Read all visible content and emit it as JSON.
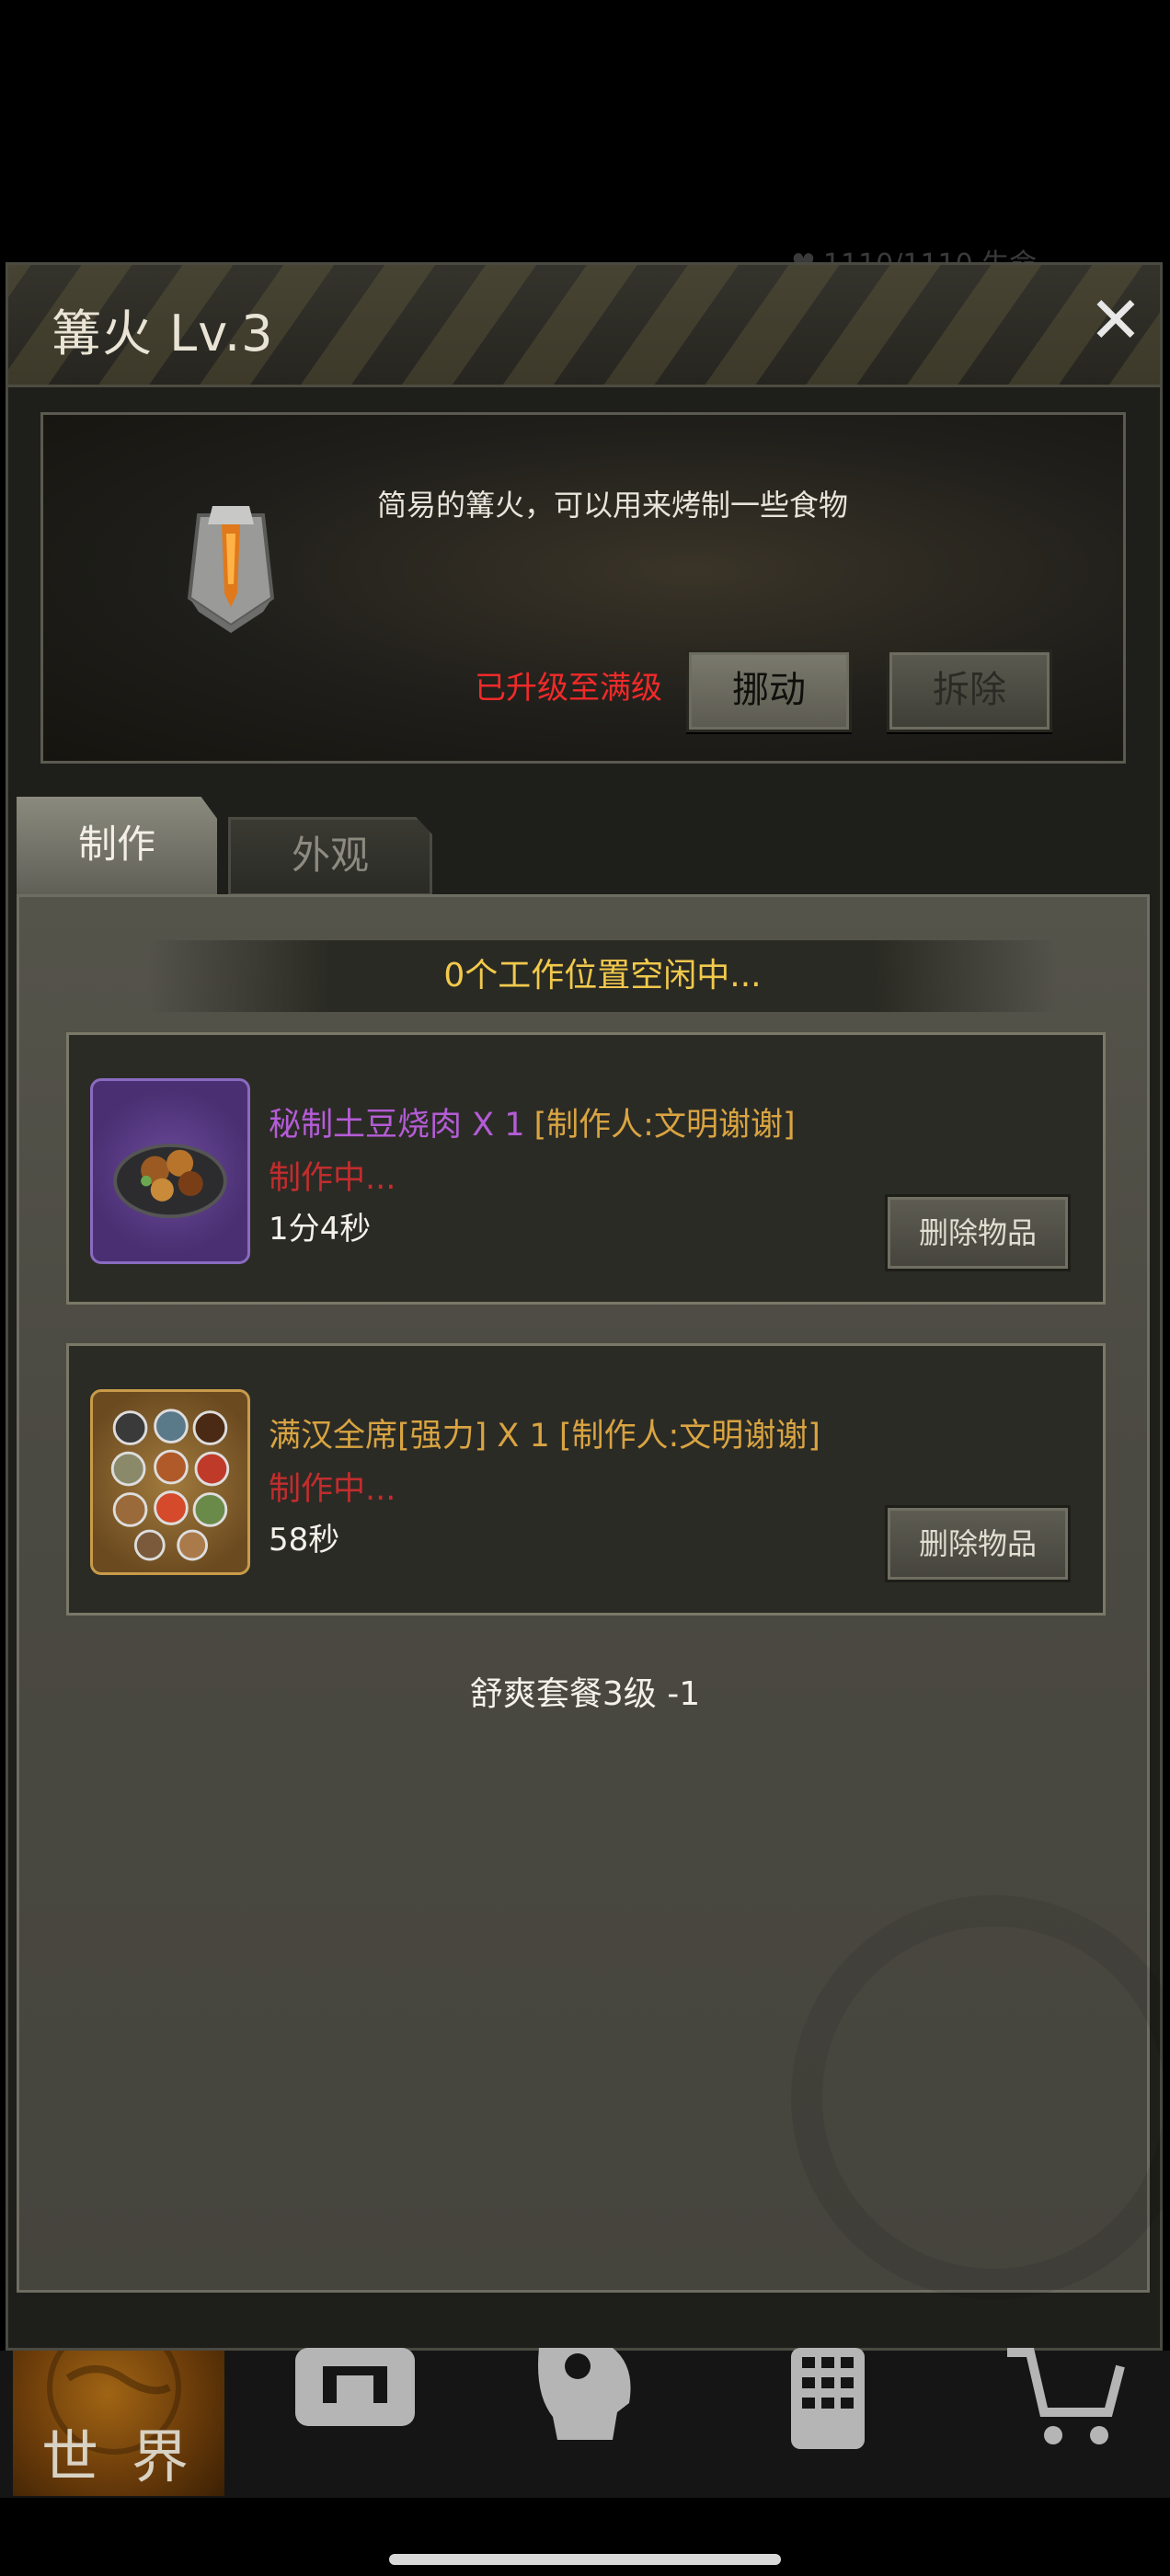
{
  "behind": {
    "status": "1110/1110   生命"
  },
  "panel": {
    "title": "篝火 Lv.3",
    "close_glyph": "✕"
  },
  "info": {
    "description": "简易的篝火，可以用来烤制一些食物",
    "max_level_text": "已升级至满级",
    "move_label": "挪动",
    "dismantle_label": "拆除"
  },
  "tabs": [
    {
      "label": "制作",
      "active": true
    },
    {
      "label": "外观",
      "active": false
    }
  ],
  "craft": {
    "slots_text": "0个工作位置空闲中...",
    "items": [
      {
        "name": "秘制土豆烧肉 X 1",
        "maker": "[制作人:文明谢谢]",
        "status": "制作中...",
        "time": "1分4秒",
        "delete_label": "删除物品",
        "name_color": "#b45cd6"
      },
      {
        "name": "满汉全席[强力] X 1",
        "maker": "[制作人:文明谢谢]",
        "status": "制作中...",
        "time": "58秒",
        "delete_label": "删除物品",
        "name_color": "#d9a441"
      }
    ],
    "bonus_text": "舒爽套餐3级 -1"
  },
  "bottom_nav": {
    "world_label": "世 界",
    "icons": [
      "backpack-icon",
      "head-gear-icon",
      "phone-keypad-icon",
      "cart-icon"
    ]
  },
  "colors": {
    "accent_yellow": "#f2c94c",
    "status_red": "#c22d2d",
    "max_red": "#f02a2a"
  }
}
